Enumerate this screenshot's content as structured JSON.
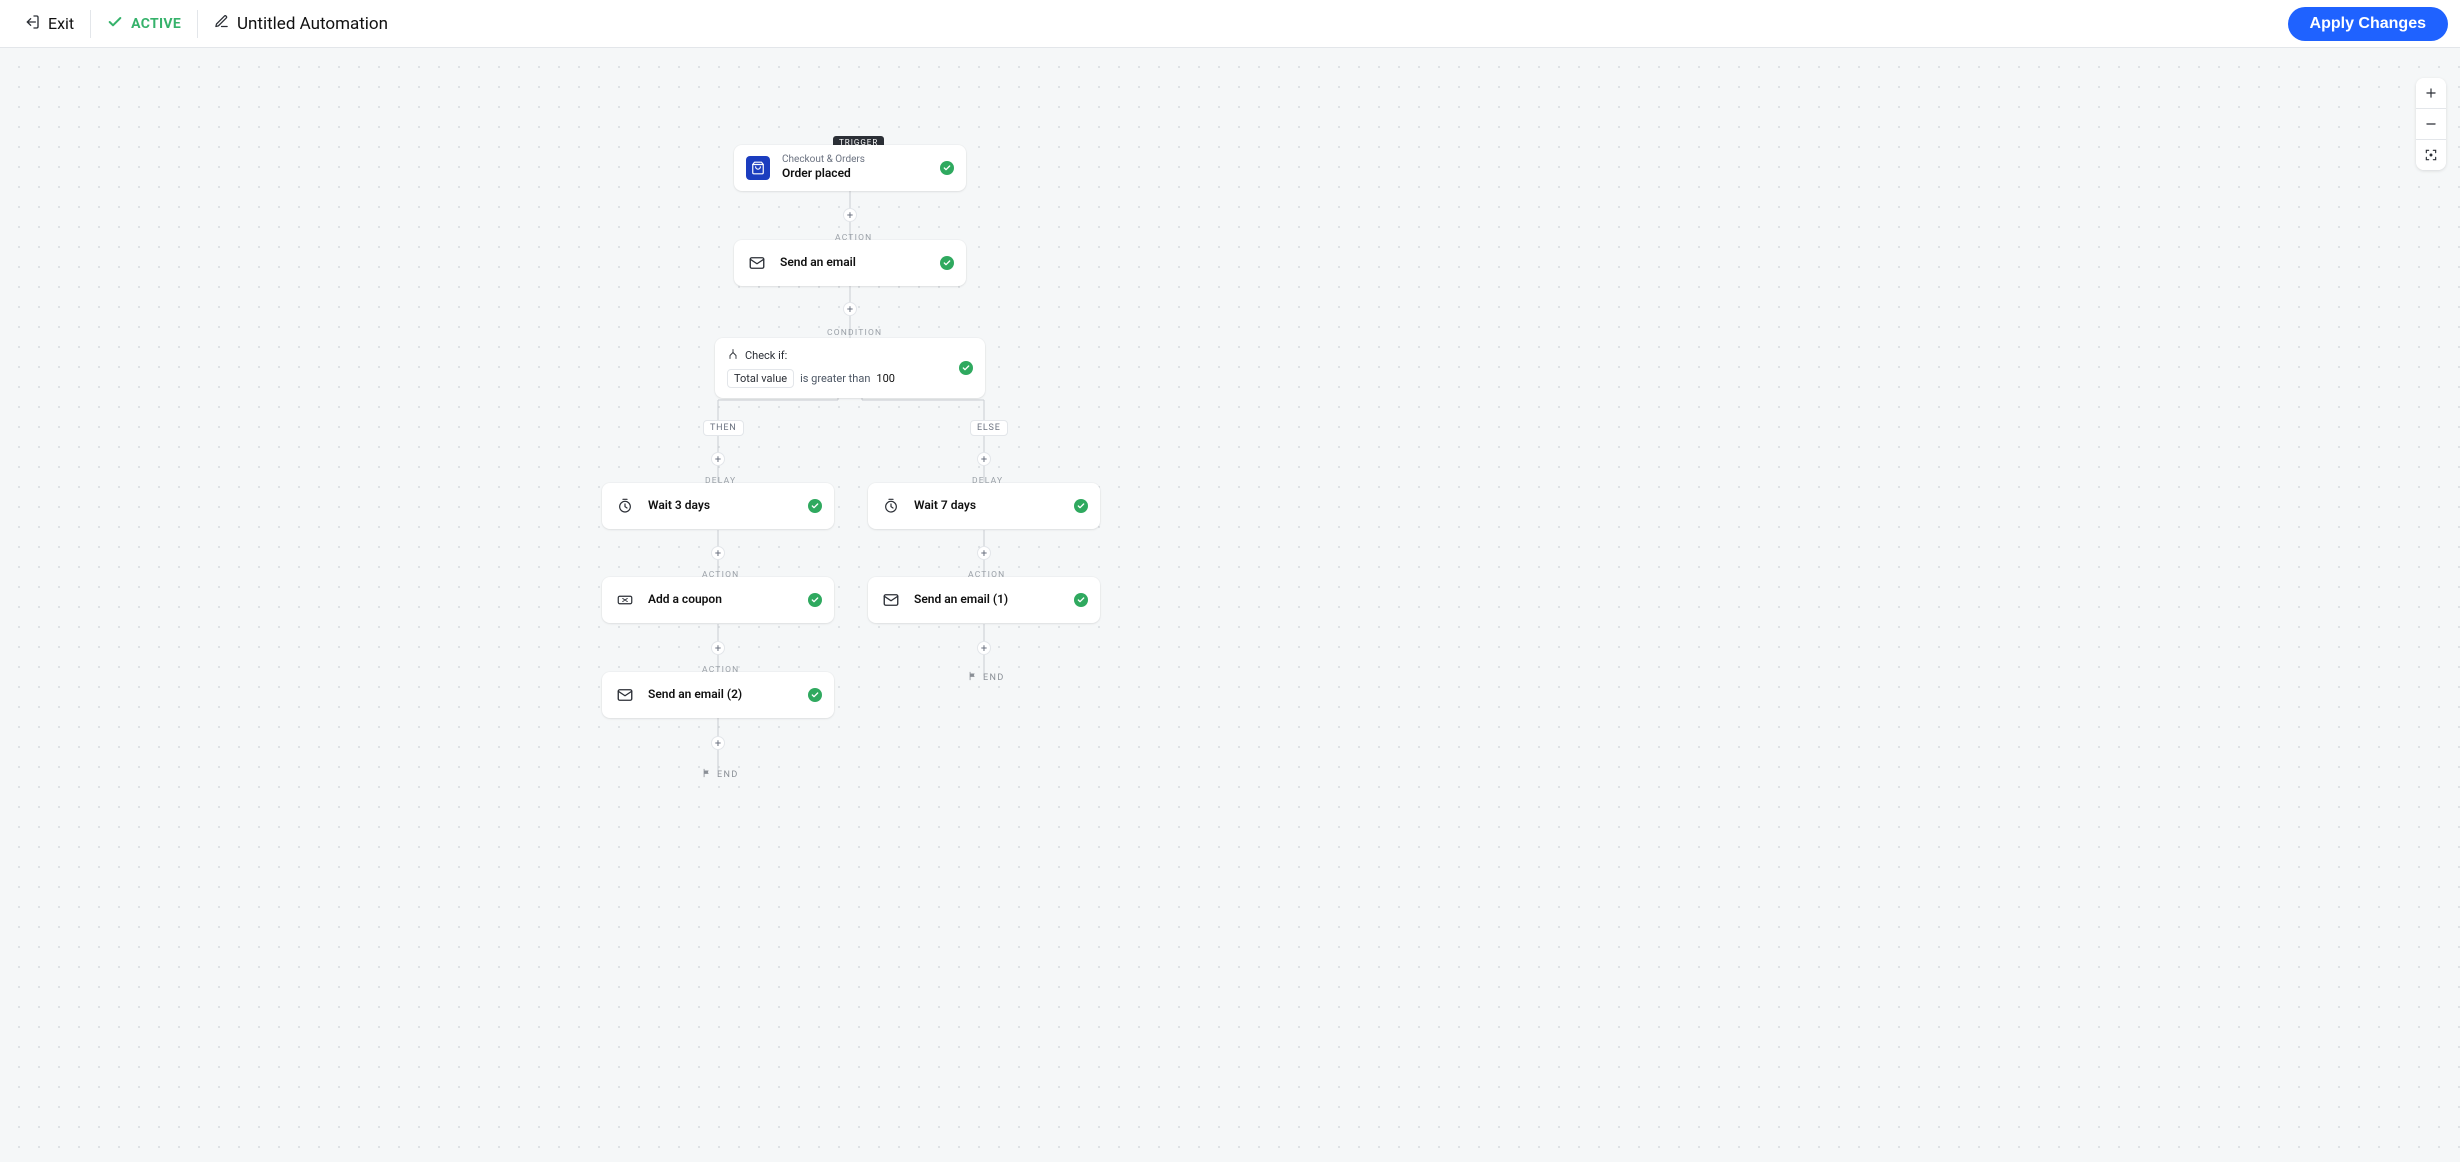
{
  "header": {
    "exit": "Exit",
    "status": "ACTIVE",
    "title": "Untitled Automation",
    "apply": "Apply Changes"
  },
  "labels": {
    "trigger": "TRIGGER",
    "action": "ACTION",
    "condition": "CONDITION",
    "delay": "DELAY",
    "then": "THEN",
    "else": "ELSE",
    "end": "END"
  },
  "nodes": {
    "trigger": {
      "eyebrow": "Checkout & Orders",
      "title": "Order placed"
    },
    "sendEmail": {
      "title": "Send an email"
    },
    "condition": {
      "checkIf": "Check if:",
      "field": "Total value",
      "operator": "is greater than",
      "value": "100"
    },
    "wait3": {
      "title": "Wait 3 days"
    },
    "wait7": {
      "title": "Wait 7 days"
    },
    "addCoupon": {
      "title": "Add a coupon"
    },
    "sendEmail1": {
      "title": "Send an email (1)"
    },
    "sendEmail2": {
      "title": "Send an email (2)"
    }
  }
}
